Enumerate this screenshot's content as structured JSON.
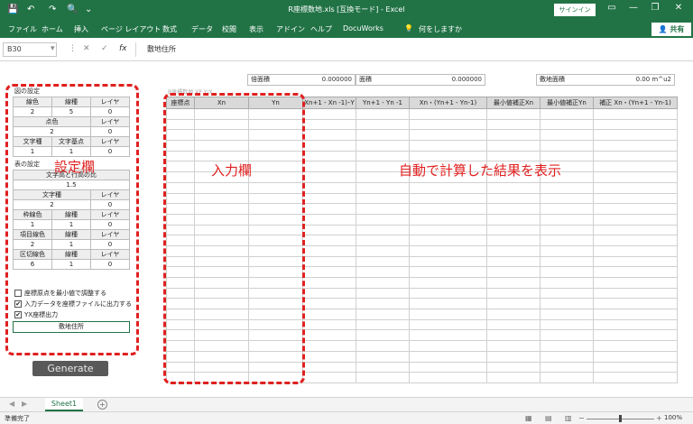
{
  "window": {
    "title": "R座標数地.xls [互換モード] - Excel",
    "signin": "サインイン",
    "minimize_icon": "—",
    "restore_icon": "❐",
    "close_icon": "✕",
    "display_icon": "▭"
  },
  "qat": {
    "save_icon": "💾",
    "undo_icon": "↶",
    "redo_icon": "↷",
    "preview_icon": "🔍",
    "more_icon": "⌄"
  },
  "ribbon": {
    "tabs": [
      "ファイル",
      "ホーム",
      "挿入",
      "ページ レイアウト",
      "数式",
      "データ",
      "校閲",
      "表示",
      "アドイン",
      "ヘルプ",
      "DocuWorks"
    ],
    "tell_me": "何をしますか",
    "bulb_icon": "💡",
    "share": "共有",
    "share_icon": "👤"
  },
  "formula_bar": {
    "name_box": "B30",
    "name_dropdown": "▾",
    "sep": "⋮",
    "cancel": "✕",
    "enter": "✓",
    "fx": "fx",
    "content": "敷地住所"
  },
  "left": {
    "draw_title": "図の設定",
    "r1": [
      "線色",
      "線種",
      "レイヤ"
    ],
    "r1v": [
      "2",
      "5",
      "0"
    ],
    "r2": [
      "点色",
      "レイヤ"
    ],
    "r2v": [
      "2",
      "0"
    ],
    "r3": [
      "文字種",
      "文字基点",
      "レイヤ"
    ],
    "r3v": [
      "1",
      "1",
      "0"
    ],
    "table_title": "表の設定",
    "ratio_label": "文字高と行高の比",
    "ratio_value": "1.5",
    "r4": [
      "文字種",
      "レイヤ"
    ],
    "r4v": [
      "2",
      "0"
    ],
    "r5": [
      "枠線色",
      "線種",
      "レイヤ"
    ],
    "r5v": [
      "1",
      "1",
      "0"
    ],
    "r6": [
      "項目線色",
      "線種",
      "レイヤ"
    ],
    "r6v": [
      "2",
      "1",
      "0"
    ],
    "r7": [
      "区切線色",
      "線種",
      "レイヤ"
    ],
    "r7v": [
      "6",
      "1",
      "0"
    ],
    "chk": [
      "座標原点を最小値で調整する",
      "入力データを座標ファイルに出力する",
      "YX座標出力"
    ],
    "chk_marks": [
      "",
      "✔",
      "✔"
    ],
    "address_button": "敷地住所",
    "generate": "Generate"
  },
  "annotations": {
    "settings": "設定欄",
    "input": "入力欄",
    "auto": "自動で計算した結果を表示"
  },
  "info": {
    "ba_label": "倍面積",
    "ba_value": "0.000000",
    "area_label": "面積",
    "area_value": "0.000000",
    "site_label": "敷地面積",
    "site_value": "0.00 m^u2"
  },
  "faint_label": "R座標数地 XP  Y/X",
  "headers": [
    "座標点",
    "Xn",
    "Yn",
    "Xn+1 - Xn -1)･Y",
    "Yn+1 - Yn -1",
    "Xn・(Yn+1 - Yn-1)",
    "最小値補正Xn",
    "最小値補正Yn",
    "補正 Xn・(Yn+1 - Yn-1)"
  ],
  "sheet_tab": "Sheet1",
  "tabs_nav": {
    "prev": "◀",
    "next": "▶",
    "add": "+"
  },
  "status": "準備完了",
  "zoom": "100%",
  "zoom_minus": "−",
  "zoom_plus": "+",
  "view_icons": [
    "▦",
    "▤",
    "▥"
  ]
}
